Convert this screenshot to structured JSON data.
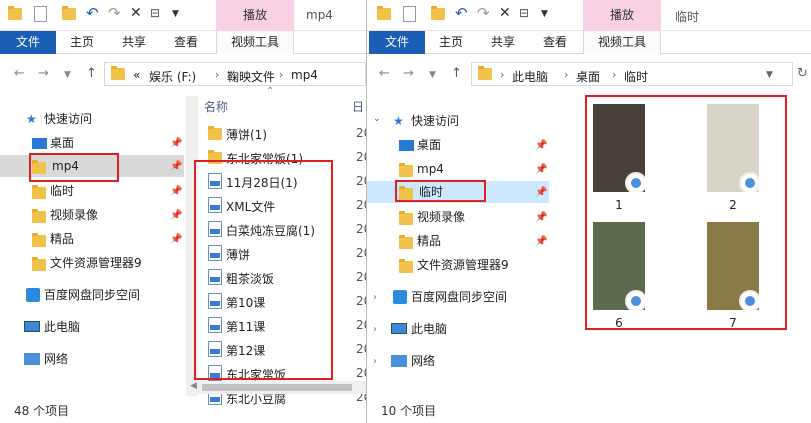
{
  "left": {
    "context_tab": "播放",
    "title": "mp4",
    "tabs": [
      "文件",
      "主页",
      "共享",
      "查看",
      "视频工具"
    ],
    "breadcrumb": {
      "overflow": "«",
      "parts": [
        "娱乐 (F:)",
        "鞠映文件",
        "mp4"
      ]
    },
    "nav": {
      "quick_access": "快速访问",
      "items": [
        "桌面",
        "mp4",
        "临时",
        "视频录像",
        "精品",
        "文件资源管理器9"
      ],
      "baidu": "百度网盘同步空间",
      "pc": "此电脑",
      "network": "网络"
    },
    "header_name": "名称",
    "header_date": "日",
    "files": [
      {
        "name": "薄饼(1)",
        "type": "folder",
        "date": "20"
      },
      {
        "name": "东北家常饭(1)",
        "type": "folder",
        "date": "20"
      },
      {
        "name": "11月28日(1)",
        "type": "video",
        "date": "20"
      },
      {
        "name": "XML文件",
        "type": "video",
        "date": "20"
      },
      {
        "name": "白菜炖冻豆腐(1)",
        "type": "video",
        "date": "20"
      },
      {
        "name": "薄饼",
        "type": "video",
        "date": "20"
      },
      {
        "name": "粗茶淡饭",
        "type": "video",
        "date": "20"
      },
      {
        "name": "第10课",
        "type": "video",
        "date": "20"
      },
      {
        "name": "第11课",
        "type": "video",
        "date": "20"
      },
      {
        "name": "第12课",
        "type": "video",
        "date": "20"
      },
      {
        "name": "东北家常饭",
        "type": "video",
        "date": "20"
      },
      {
        "name": "东北小豆腐",
        "type": "video",
        "date": "20"
      }
    ],
    "status": "48 个项目"
  },
  "right": {
    "context_tab": "播放",
    "title": "临时",
    "tabs": [
      "文件",
      "主页",
      "共享",
      "查看",
      "视频工具"
    ],
    "breadcrumb": {
      "parts": [
        "此电脑",
        "桌面",
        "临时"
      ]
    },
    "nav": {
      "quick_access": "快速访问",
      "items": [
        "桌面",
        "mp4",
        "临时",
        "视频录像",
        "精品",
        "文件资源管理器9"
      ],
      "baidu": "百度网盘同步空间",
      "pc": "此电脑",
      "network": "网络"
    },
    "thumbs": [
      {
        "label": "1",
        "bg": "#4a403a"
      },
      {
        "label": "2",
        "bg": "#d9d4c8"
      },
      {
        "label": "6",
        "bg": "#5e6a50"
      },
      {
        "label": "7",
        "bg": "#8a7a4a"
      }
    ],
    "status": "10 个项目"
  },
  "colors": {
    "file_tab": "#1a5fb4",
    "context_tab": "#f8d2e4",
    "highlight": "#e02020",
    "selected": "#cce8ff"
  }
}
